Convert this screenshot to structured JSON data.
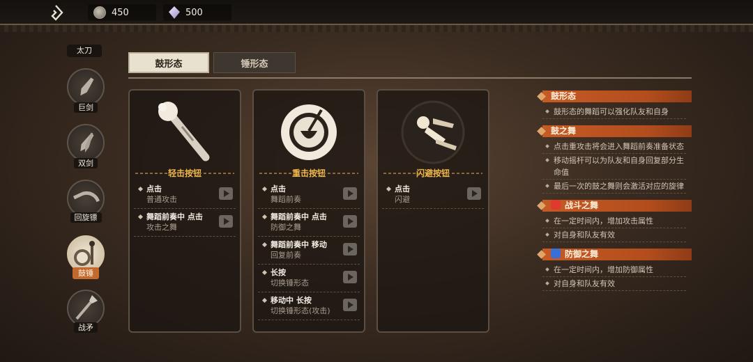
{
  "topbar": {
    "coins": "450",
    "gems": "500"
  },
  "weapons": {
    "header": "太刀",
    "items": [
      {
        "label": "巨剑",
        "icon": "greatsword-icon"
      },
      {
        "label": "双剑",
        "icon": "dual-blades-icon"
      },
      {
        "label": "回旋镖",
        "icon": "boomerang-icon"
      },
      {
        "label": "鼓锤",
        "icon": "drum-hammer-icon",
        "active": true
      },
      {
        "label": "战矛",
        "icon": "spear-icon"
      }
    ]
  },
  "tabs": {
    "active": "鼓形态",
    "inactive": "锤形态"
  },
  "panels": [
    {
      "title": "轻击按钮",
      "rows": [
        {
          "action": "点击",
          "result": "普通攻击"
        },
        {
          "action": "舞蹈前奏中 点击",
          "result": "攻击之舞"
        }
      ]
    },
    {
      "title": "重击按钮",
      "rows": [
        {
          "action": "点击",
          "result": "舞蹈前奏"
        },
        {
          "action": "舞蹈前奏中 点击",
          "result": "防御之舞"
        },
        {
          "action": "舞蹈前奏中 移动",
          "result": "回复前奏"
        },
        {
          "action": "长按",
          "result": "切换锤形态"
        },
        {
          "action": "移动中 长按",
          "result": "切换锤形态(攻击)"
        }
      ]
    },
    {
      "title": "闪避按钮",
      "rows": [
        {
          "action": "点击",
          "result": "闪避"
        }
      ]
    }
  ],
  "info": {
    "drum_form": {
      "title": "鼓形态",
      "lines": [
        "鼓形态的舞蹈可以强化队友和自身"
      ]
    },
    "drum_dance": {
      "title": "鼓之舞",
      "lines": [
        "点击重攻击将会进入舞蹈前奏准备状态",
        "移动摇杆可以为队友和自身回复部分生命值",
        "最后一次的鼓之舞则会激活对应的旋律"
      ]
    },
    "battle_dance": {
      "title": "战斗之舞",
      "lines": [
        "在一定时间内，增加攻击属性",
        "对自身和队友有效"
      ]
    },
    "defense_dance": {
      "title": "防御之舞",
      "lines": [
        "在一定时间内，增加防御属性",
        "对自身和队友有效"
      ]
    }
  }
}
